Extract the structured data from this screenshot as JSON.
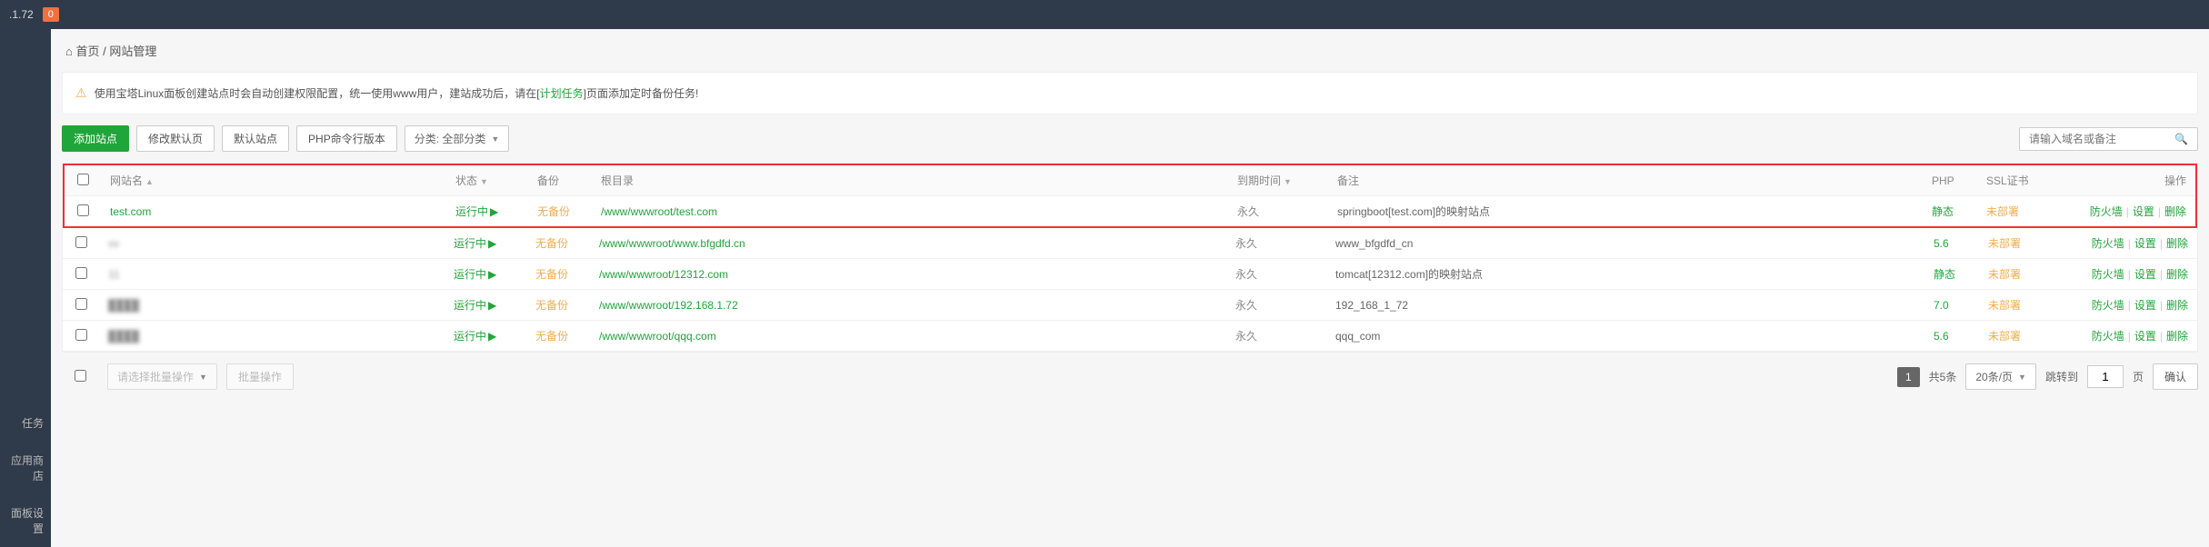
{
  "topbar": {
    "ip_suffix": ".1.72",
    "badge": "0"
  },
  "sidebar": {
    "items": [
      "任务",
      "应用商店",
      "面板设置"
    ]
  },
  "breadcrumb": {
    "home": "首页",
    "sep": " / ",
    "current": "网站管理"
  },
  "alert": {
    "pre": "使用宝塔Linux面板创建站点时会自动创建权限配置，统一使用www用户，建站成功后，请在[",
    "link": "计划任务",
    "post": "]页面添加定时备份任务!"
  },
  "toolbar": {
    "add": "添加站点",
    "default_page": "修改默认页",
    "default_site": "默认站点",
    "php_cli": "PHP命令行版本",
    "category": "分类: 全部分类",
    "search_ph": "请输入域名或备注"
  },
  "thead": {
    "name": "网站名",
    "status": "状态",
    "backup": "备份",
    "root": "根目录",
    "expire": "到期时间",
    "note": "备注",
    "php": "PHP",
    "ssl": "SSL证书",
    "ops": "操作"
  },
  "status_running": "运行中",
  "backup_none": "无备份",
  "expire_forever": "永久",
  "ssl_none": "未部署",
  "php_static": "静态",
  "ops": {
    "fw": "防火墙",
    "cfg": "设置",
    "del": "删除"
  },
  "rows": [
    {
      "name": "test.com",
      "root": "/www/wwwroot/test.com",
      "note": "springboot[test.com]的映射站点",
      "php": "静态",
      "blur": false
    },
    {
      "name": "v",
      "root": "/www/wwwroot/www.bfgdfd.cn",
      "note": "www_bfgdfd_cn",
      "php": "5.6",
      "blur": true
    },
    {
      "name": "1",
      "root": "/www/wwwroot/12312.com",
      "note": "tomcat[12312.com]的映射站点",
      "php": "静态",
      "blur": true
    },
    {
      "name": "",
      "root": "/www/wwwroot/192.168.1.72",
      "note": "192_168_1_72",
      "php": "7.0",
      "blur": true
    },
    {
      "name": "",
      "root": "/www/wwwroot/qqq.com",
      "note": "qqq_com",
      "php": "5.6",
      "blur": true
    }
  ],
  "batch": {
    "select_ph": "请选择批量操作",
    "exec": "批量操作"
  },
  "pager": {
    "current": "1",
    "total": "共5条",
    "per": "20条/页",
    "goto_pre": "跳转到",
    "goto_val": "1",
    "goto_post": "页",
    "confirm": "确认"
  }
}
